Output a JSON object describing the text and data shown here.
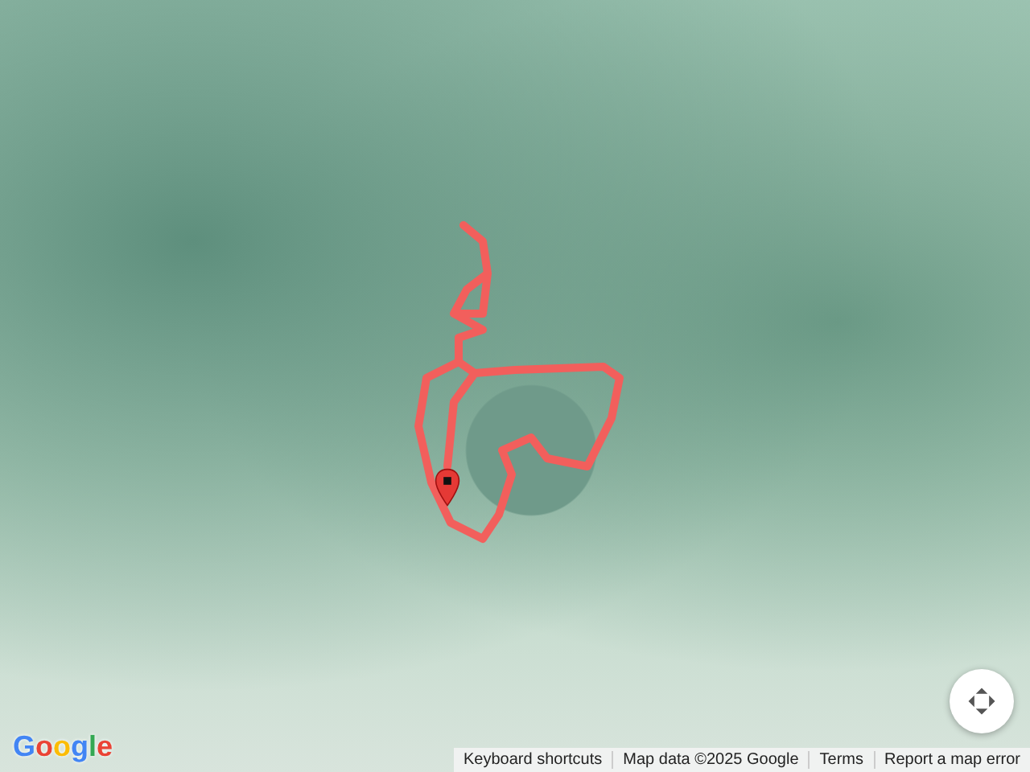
{
  "map": {
    "logo": "Google",
    "attribution": [
      {
        "label": "Keyboard shortcuts"
      },
      {
        "label": "Map data ©2025 Google"
      },
      {
        "label": "Terms"
      },
      {
        "label": "Report a map error"
      }
    ]
  }
}
